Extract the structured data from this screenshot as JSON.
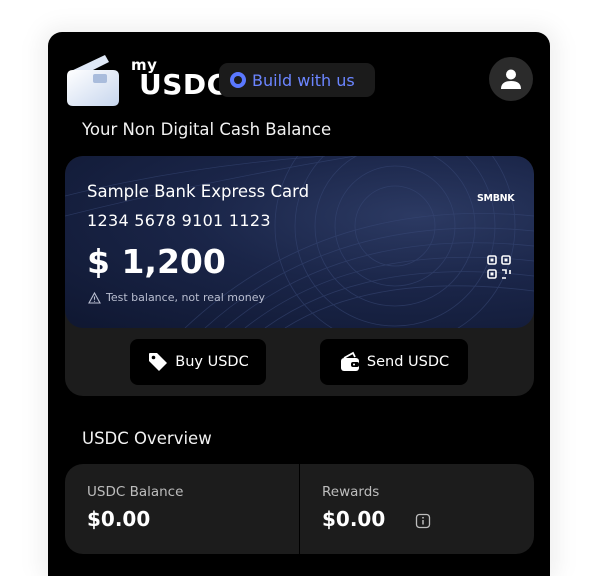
{
  "header": {
    "logo_my": "my",
    "logo_usdc": "USDC",
    "build_button": "Build with us",
    "profile_icon": "user-icon"
  },
  "cash_section": {
    "title": "Your Non Digital Cash Balance",
    "card": {
      "name": "Sample Bank Express Card",
      "number": "1234 5678 9101 1123",
      "amount": "$ 1,200",
      "note": "Test balance, not real money",
      "brand": "SMBNK",
      "qr_icon": "qr-code-icon"
    },
    "actions": {
      "buy_label": "Buy USDC",
      "buy_icon": "tag-icon",
      "send_label": "Send USDC",
      "send_icon": "wallet-icon"
    }
  },
  "overview": {
    "title": "USDC Overview",
    "balance_label": "USDC Balance",
    "balance_value": "$0.00",
    "rewards_label": "Rewards",
    "rewards_value": "$0.00",
    "info_icon": "info-icon"
  },
  "colors": {
    "background": "#000000",
    "panel": "#1c1c1c",
    "accent": "#6b85ff",
    "card_blue": "#1a2548"
  }
}
